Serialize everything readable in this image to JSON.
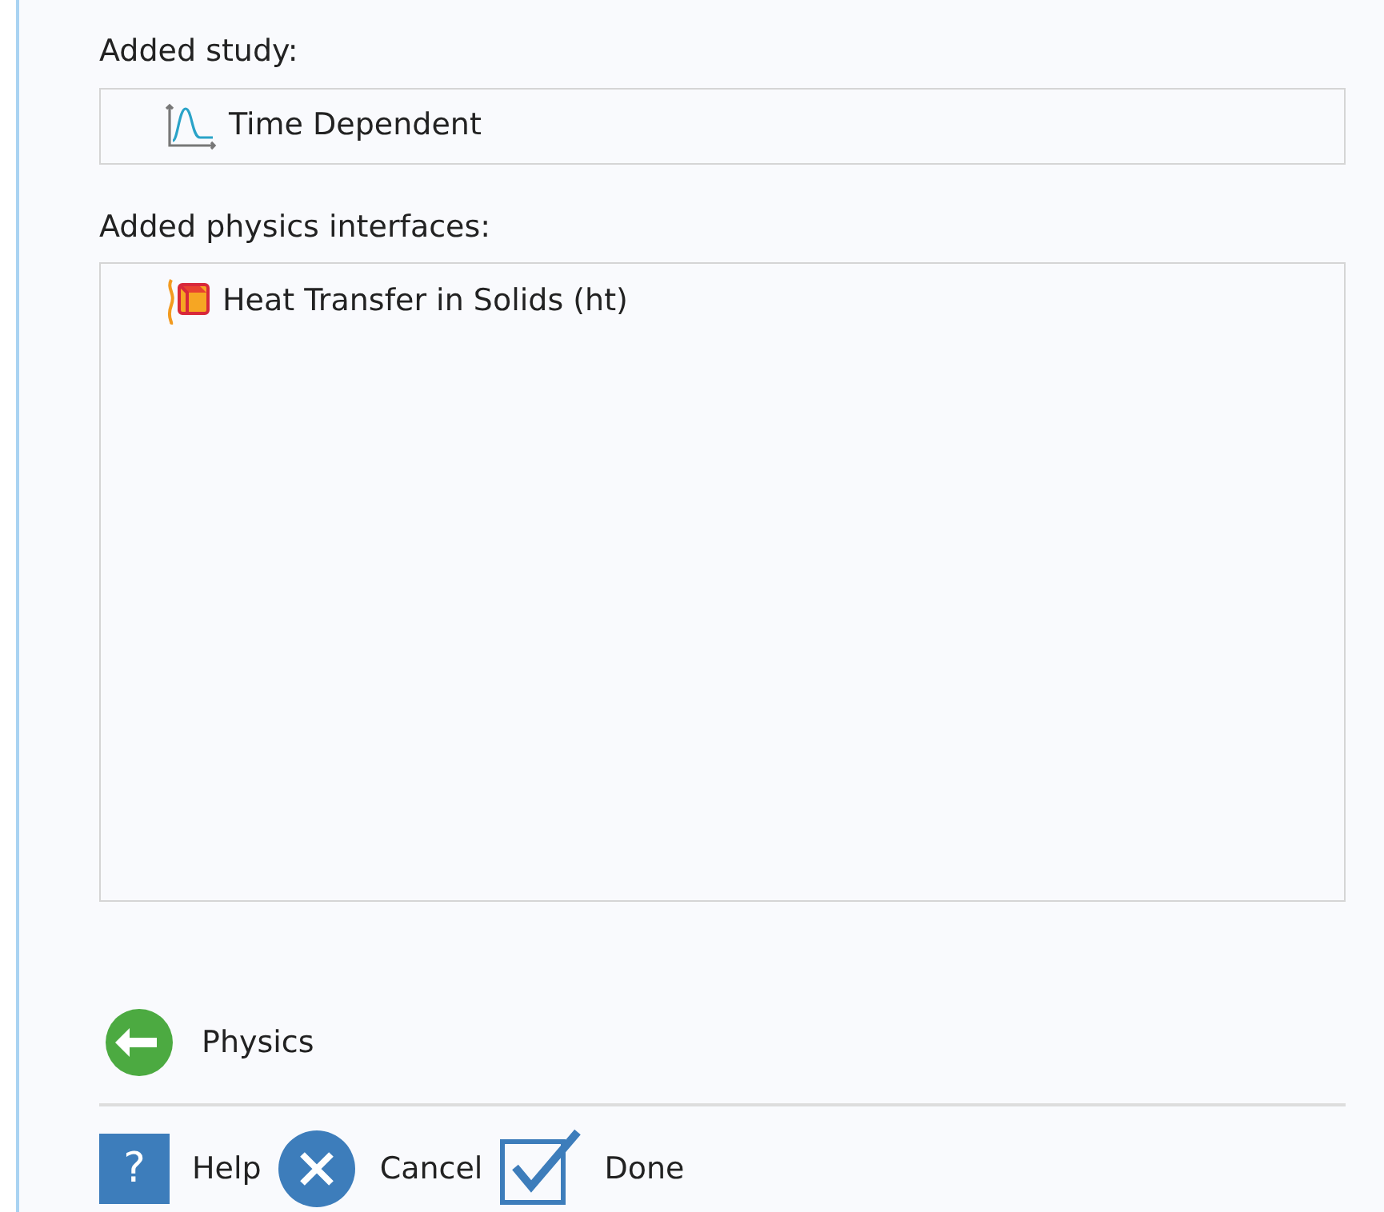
{
  "study": {
    "label": "Added study:",
    "item": "Time Dependent"
  },
  "physics": {
    "label": "Added physics interfaces:",
    "items": [
      {
        "text": "Heat Transfer in Solids (ht)"
      }
    ]
  },
  "back_button": {
    "label": "Physics"
  },
  "buttons": [
    {
      "kind": "help",
      "label": "Help",
      "glyph": "?"
    },
    {
      "kind": "cancel",
      "label": "Cancel"
    },
    {
      "kind": "done",
      "label": "Done"
    }
  ]
}
